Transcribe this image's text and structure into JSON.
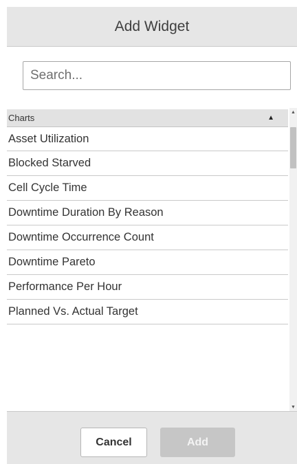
{
  "dialog": {
    "title": "Add Widget",
    "search": {
      "placeholder": "Search...",
      "value": ""
    },
    "group": {
      "label": "Charts",
      "toggle_icon": "triangle-up-icon"
    },
    "items": [
      "Asset Utilization",
      "Blocked Starved",
      "Cell Cycle Time",
      "Downtime Duration By Reason",
      "Downtime Occurrence Count",
      "Downtime Pareto",
      "Performance Per Hour",
      "Planned Vs. Actual Target"
    ],
    "buttons": {
      "cancel": "Cancel",
      "add": "Add"
    }
  }
}
